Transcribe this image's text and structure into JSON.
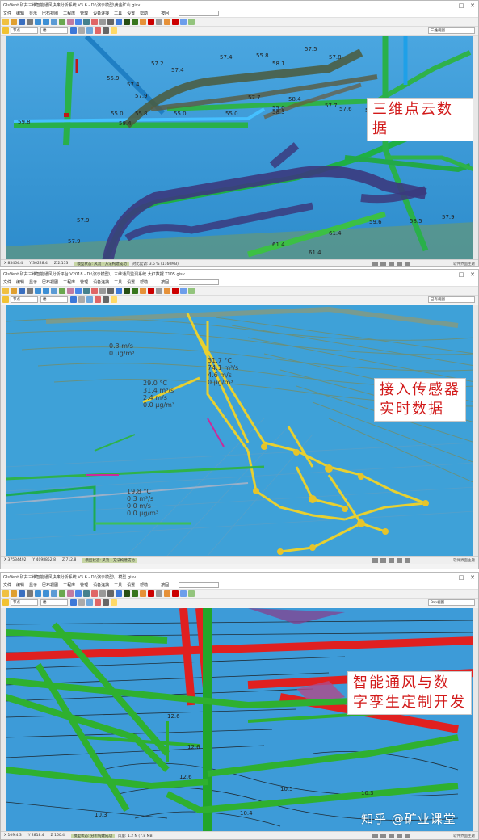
{
  "common": {
    "menu": [
      "文件",
      "编辑",
      "显示",
      "巴布视图",
      "工程库",
      "管理",
      "设备连接",
      "工具",
      "设置",
      "帮助"
    ],
    "search_label": "按回",
    "view_select": "节点",
    "layer_select": "楼",
    "window_controls": [
      "—",
      "□",
      "✕"
    ]
  },
  "window1": {
    "title": "GIsVent 矿井三维智能通风决策分析系统 V3.6 - D:\\演示模型\\黄金矿山.gisv",
    "right_view": "三维视图",
    "point_labels": [
      "57.4",
      "57.4",
      "55.9",
      "57.2",
      "57.4",
      "57.9",
      "55.8",
      "57.5",
      "58.1",
      "57.8",
      "59.8",
      "58.4",
      "55.0",
      "55.8",
      "55.0",
      "55.0",
      "58.4",
      "55.0",
      "57.7",
      "58.3",
      "57.6",
      "57.7",
      "58.5",
      "58.5",
      "58.5",
      "57.6",
      "57.9",
      "57.9",
      "61.4",
      "57.9",
      "59.6",
      "61.4",
      "58.5",
      "61.4"
    ],
    "caption": "三维点云数据",
    "status": {
      "x": "X 85464.4",
      "y": "Y 30228.4",
      "z": "Z 2.153",
      "mode": "模型状态: 风流 - 方法构建成功",
      "extra": "对比度调: 3.5 %   (1160MB)",
      "link": "软件界面主题"
    }
  },
  "window2": {
    "title": "GIsVent 矿井三维智能通风分析平台 V2018 - D:\\演示模型\\...三维通风监测系统 大红数据 T105.gisv",
    "right_view": "已有视图",
    "sensors": [
      {
        "lines": [
          "31.7 °C",
          "74.1 m³/s",
          "4.6 m/s",
          "0 μg/m³"
        ]
      },
      {
        "lines": [
          "29.0 °C",
          "31.4 m³/s",
          "2.4 m/s",
          "0.0 μg/m³"
        ]
      },
      {
        "lines": [
          "0.3 m/s",
          "0 μg/m³"
        ]
      },
      {
        "lines": [
          "19.8 °C",
          "0.3 m³/s",
          "0.0 m/s",
          "0.0 μg/m³"
        ]
      }
    ],
    "caption_lines": [
      "接入传感器",
      "实时数据"
    ],
    "status": {
      "x": "X 37534492",
      "y": "Y 4098852.8",
      "z": "Z 712.8",
      "mode": "模型状态: 风流 - 方法构建成功",
      "link": "软件界面主题"
    }
  },
  "window3": {
    "title": "GIsVent 矿井三维智能通风决策分析系统 V3.6 - D:\\演示模型\\...模型.gisv",
    "right_view": "Pop视图",
    "point_labels": [
      "12.6",
      "12.6",
      "10.3",
      "10.5",
      "12.6",
      "10.3",
      "10.4"
    ],
    "caption_lines": [
      "智能通风与数",
      "字孪生定制开发"
    ],
    "watermark": "知乎 @矿业课堂",
    "status": {
      "x": "X 109.4.3",
      "y": "Y 2818.4",
      "z": "Z 160.4",
      "mode": "模型状态: 分析构建成功",
      "extra": "风量: 1.2 N   (7.8 MB)",
      "link": "软件界面主题"
    }
  },
  "colors": {
    "sky": "#3aa0d6",
    "green_pipe": "#2fb24a",
    "red_pipe": "#e02020",
    "yellow_pipe": "#e8d030",
    "cloud": "#3b3a7e",
    "caption_red": "#d21a1a"
  }
}
